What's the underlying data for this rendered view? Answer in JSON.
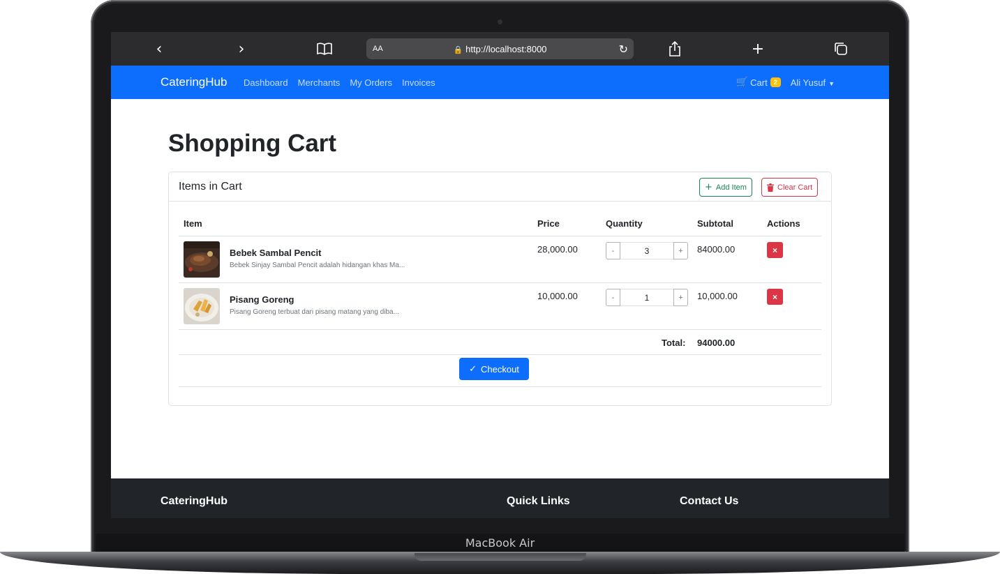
{
  "device": {
    "label": "MacBook Air"
  },
  "browser": {
    "back_icon": "chevron-left-icon",
    "forward_icon": "chevron-right-icon",
    "aa_label": "AA",
    "url": "http://localhost:8000"
  },
  "navbar": {
    "brand": "CateringHub",
    "links": [
      "Dashboard",
      "Merchants",
      "My Orders",
      "Invoices"
    ],
    "cart_label": "Cart",
    "cart_count": "2",
    "user_name": "Ali Yusuf",
    "color": "#0d6efd"
  },
  "main": {
    "title": "Shopping Cart",
    "card_title": "Items in Cart",
    "add_item_label": "Add Item",
    "clear_cart_label": "Clear Cart",
    "columns": [
      "Item",
      "Price",
      "Quantity",
      "Subtotal",
      "Actions"
    ],
    "items": [
      {
        "name": "Bebek Sambal Pencit",
        "description": "Bebek Sinjay Sambal Pencit adalah hidangan khas Ma...",
        "price": "28,000.00",
        "quantity": "3",
        "subtotal": "84000.00",
        "minus": "-",
        "plus": "+",
        "delete": "×"
      },
      {
        "name": "Pisang Goreng",
        "description": "Pisang Goreng terbuat dari pisang matang yang diba...",
        "price": "10,000.00",
        "quantity": "1",
        "subtotal": "10,000.00",
        "minus": "-",
        "plus": "+",
        "delete": "×"
      }
    ],
    "total_label": "Total:",
    "total_value": "94000.00",
    "checkout_label": "Checkout"
  },
  "footer": {
    "headings": [
      "CateringHub",
      "Quick Links",
      "Contact Us"
    ]
  },
  "colors": {
    "primary": "#0d6efd",
    "success": "#198754",
    "danger": "#dc3545",
    "warning": "#ffc107",
    "dark": "#212529"
  }
}
